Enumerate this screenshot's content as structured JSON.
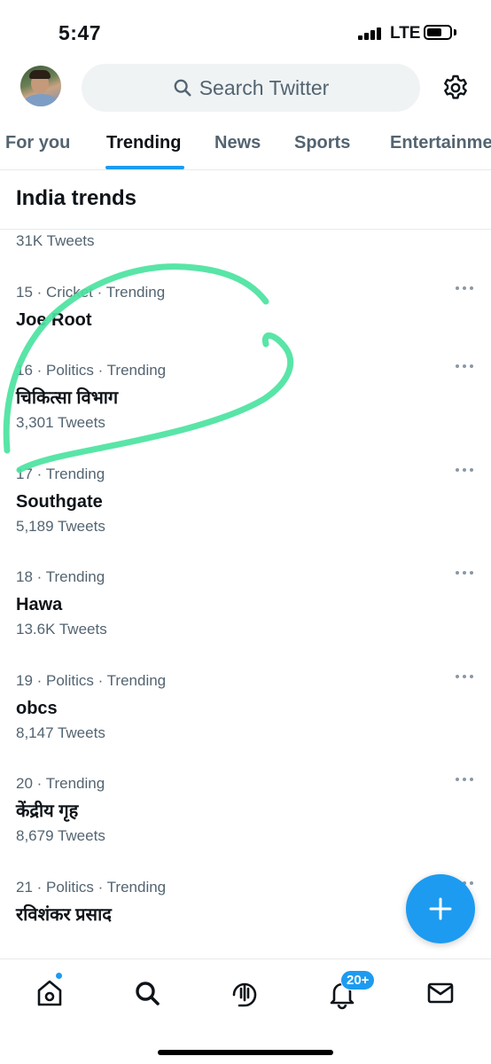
{
  "status_bar": {
    "time": "5:47",
    "network": "LTE"
  },
  "search": {
    "placeholder": "Search Twitter"
  },
  "tabs": [
    {
      "label": "For you"
    },
    {
      "label": "Trending",
      "active": true
    },
    {
      "label": "News"
    },
    {
      "label": "Sports"
    },
    {
      "label": "Entertainment"
    }
  ],
  "section": {
    "title": "India trends",
    "partial_count": "31K Tweets"
  },
  "trends": [
    {
      "meta": "15 · Cricket · Trending",
      "name": "Joe Root",
      "count": ""
    },
    {
      "meta": "16 · Politics · Trending",
      "name": "चिकित्सा विभाग",
      "count": "3,301 Tweets"
    },
    {
      "meta": "17 · Trending",
      "name": "Southgate",
      "count": "5,189 Tweets"
    },
    {
      "meta": "18 · Trending",
      "name": "Hawa",
      "count": "13.6K Tweets"
    },
    {
      "meta": "19 · Politics · Trending",
      "name": "obcs",
      "count": "8,147 Tweets"
    },
    {
      "meta": "20 · Trending",
      "name": "केंद्रीय गृह",
      "count": "8,679 Tweets"
    },
    {
      "meta": "21 · Politics · Trending",
      "name": "रविशंकर प्रसाद",
      "count": ""
    }
  ],
  "bottom_nav": {
    "items": [
      "home-icon",
      "search-icon",
      "spaces-icon",
      "notifications-icon",
      "messages-icon"
    ],
    "notifications_badge": "20+"
  },
  "colors": {
    "accent": "#1d9bf0",
    "annotation_stroke": "#4be3a0",
    "secondary_text": "#536471"
  }
}
